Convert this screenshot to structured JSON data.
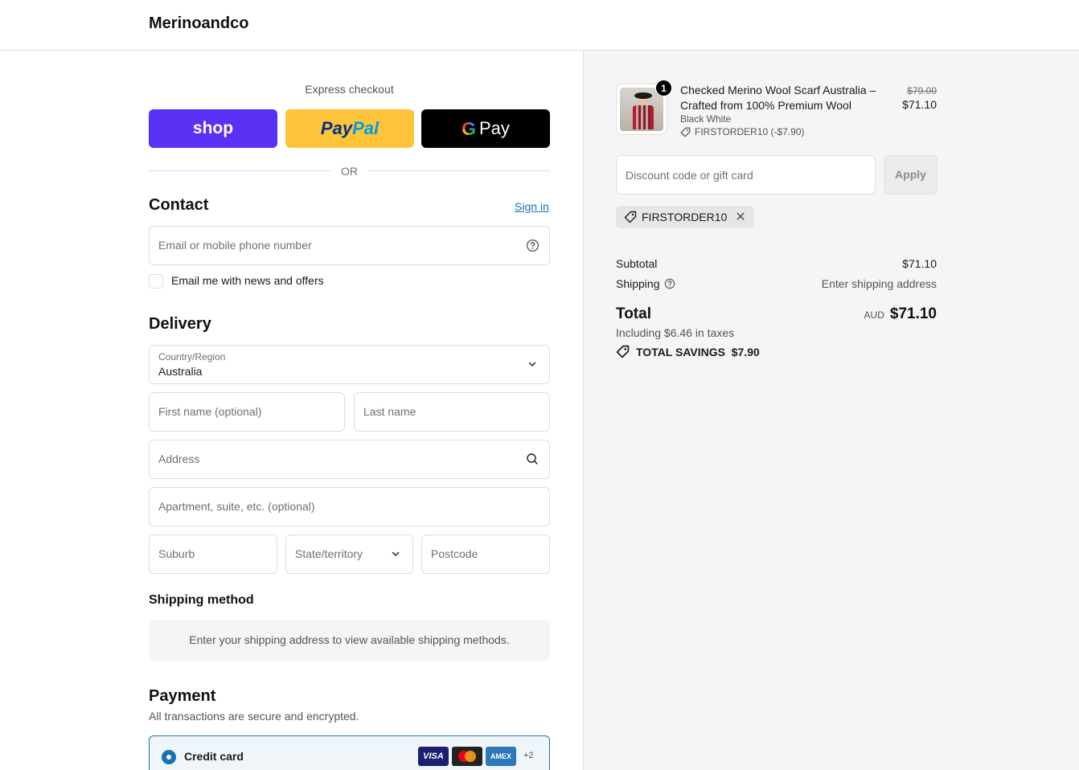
{
  "header": {
    "brand": "Merinoandco"
  },
  "express": {
    "title": "Express checkout",
    "shop_label": "shop",
    "paypal_part1": "Pay",
    "paypal_part2": "Pal",
    "gpay_g": "G",
    "gpay_label": "Pay",
    "or_label": "OR"
  },
  "contact": {
    "title": "Contact",
    "signin": "Sign in",
    "email_placeholder": "Email or mobile phone number",
    "newsletter_label": "Email me with news and offers"
  },
  "delivery": {
    "title": "Delivery",
    "country_label": "Country/Region",
    "country_value": "Australia",
    "first_name": "First name (optional)",
    "last_name": "Last name",
    "address": "Address",
    "apartment": "Apartment, suite, etc. (optional)",
    "suburb": "Suburb",
    "state": "State/territory",
    "postcode": "Postcode"
  },
  "shipping": {
    "title": "Shipping method",
    "note": "Enter your shipping address to view available shipping methods."
  },
  "payment": {
    "title": "Payment",
    "subtitle": "All transactions are secure and encrypted.",
    "credit_card_label": "Credit card",
    "cards": [
      "VISA",
      "AMEX"
    ],
    "more_cards": "+2"
  },
  "summary": {
    "badge_count": "1",
    "product_title": "Checked Merino Wool Scarf Australia – Crafted from 100% Premium Wool",
    "variant": "Black White",
    "discount_line": "FIRSTORDER10 (-$7.90)",
    "price_old": "$79.00",
    "price_new": "$71.10",
    "discount_placeholder": "Discount code or gift card",
    "apply_label": "Apply",
    "applied_code": "FIRSTORDER10",
    "subtotal_label": "Subtotal",
    "subtotal_value": "$71.10",
    "shipping_label": "Shipping",
    "shipping_value": "Enter shipping address",
    "total_label": "Total",
    "currency": "AUD",
    "total_value": "$71.10",
    "taxes": "Including $6.46 in taxes",
    "savings": "TOTAL SAVINGS  $7.90"
  },
  "colors": {
    "shop": "#5a31f4",
    "paypal": "#ffc439",
    "link": "#1773b0"
  }
}
